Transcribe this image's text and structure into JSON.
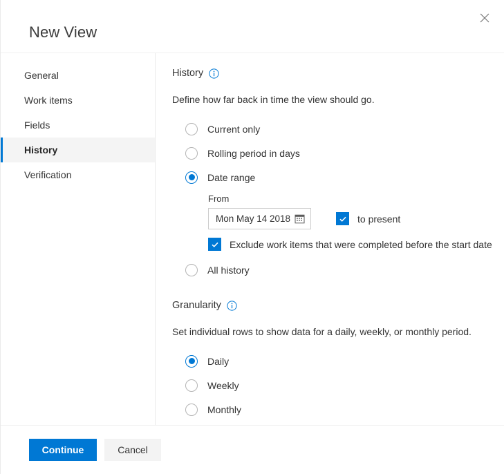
{
  "dialog": {
    "title": "New View",
    "close_icon": "close-icon"
  },
  "sidebar": {
    "items": [
      {
        "label": "General",
        "selected": false
      },
      {
        "label": "Work items",
        "selected": false
      },
      {
        "label": "Fields",
        "selected": false
      },
      {
        "label": "History",
        "selected": true
      },
      {
        "label": "Verification",
        "selected": false
      }
    ]
  },
  "history": {
    "heading": "History",
    "info_icon": "info-icon",
    "description": "Define how far back in time the view should go.",
    "options": [
      {
        "label": "Current only",
        "selected": false
      },
      {
        "label": "Rolling period in days",
        "selected": false
      },
      {
        "label": "Date range",
        "selected": true
      },
      {
        "label": "All history",
        "selected": false
      }
    ],
    "date_range": {
      "from_label": "From",
      "from_value": "Mon May 14 2018",
      "calendar_icon": "calendar-icon",
      "to_present": {
        "label": "to present",
        "checked": true
      },
      "exclude": {
        "label": "Exclude work items that were completed before the start date",
        "checked": true
      }
    }
  },
  "granularity": {
    "heading": "Granularity",
    "info_icon": "info-icon",
    "description": "Set individual rows to show data for a daily, weekly, or monthly period.",
    "options": [
      {
        "label": "Daily",
        "selected": true
      },
      {
        "label": "Weekly",
        "selected": false
      },
      {
        "label": "Monthly",
        "selected": false
      }
    ]
  },
  "footer": {
    "continue_label": "Continue",
    "cancel_label": "Cancel"
  },
  "colors": {
    "accent": "#0078d4",
    "selected_row_bg": "#f4f4f4",
    "secondary_button_bg": "#f3f3f3"
  }
}
